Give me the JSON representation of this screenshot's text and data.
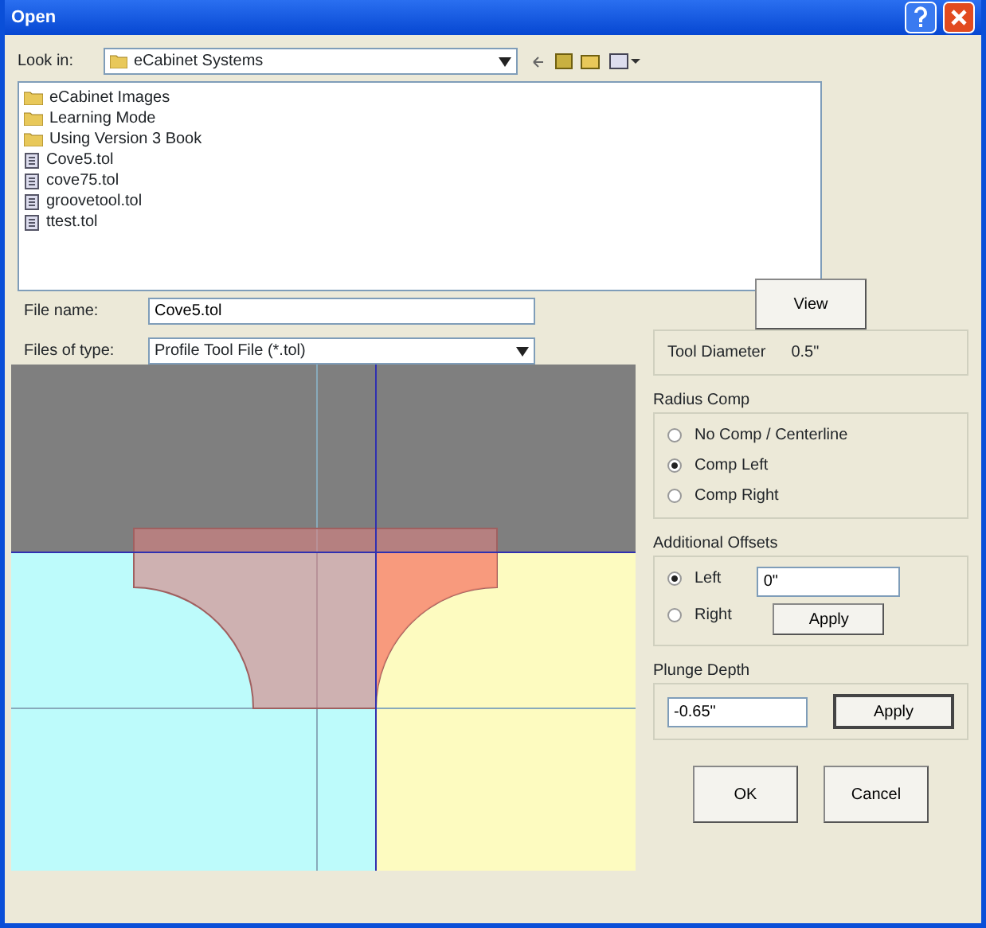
{
  "window": {
    "title": "Open"
  },
  "look_in": {
    "label": "Look in:",
    "value": "eCabinet Systems"
  },
  "files": [
    {
      "name": "eCabinet Images",
      "kind": "folder"
    },
    {
      "name": "Learning Mode",
      "kind": "folder"
    },
    {
      "name": "Using Version 3 Book",
      "kind": "folder"
    },
    {
      "name": "Cove5.tol",
      "kind": "file"
    },
    {
      "name": "cove75.tol",
      "kind": "file"
    },
    {
      "name": "groovetool.tol",
      "kind": "file"
    },
    {
      "name": "ttest.tol",
      "kind": "file"
    }
  ],
  "file_name": {
    "label": "File name:",
    "value": "Cove5.tol"
  },
  "files_of_type": {
    "label": "Files of type:",
    "value": "Profile Tool File (*.tol)"
  },
  "view_button": "View",
  "tool_diameter": {
    "label": "Tool Diameter",
    "value": "0.5\""
  },
  "radius_comp": {
    "title": "Radius Comp",
    "options": [
      {
        "label": "No Comp / Centerline",
        "selected": false
      },
      {
        "label": "Comp Left",
        "selected": true
      },
      {
        "label": "Comp Right",
        "selected": false
      }
    ]
  },
  "additional_offsets": {
    "title": "Additional Offsets",
    "options": [
      {
        "label": "Left",
        "selected": true
      },
      {
        "label": "Right",
        "selected": false
      }
    ],
    "value": "0\"",
    "apply": "Apply"
  },
  "plunge_depth": {
    "title": "Plunge Depth",
    "value": "-0.65\"",
    "apply": "Apply"
  },
  "buttons": [
    "OK",
    "Cancel"
  ]
}
